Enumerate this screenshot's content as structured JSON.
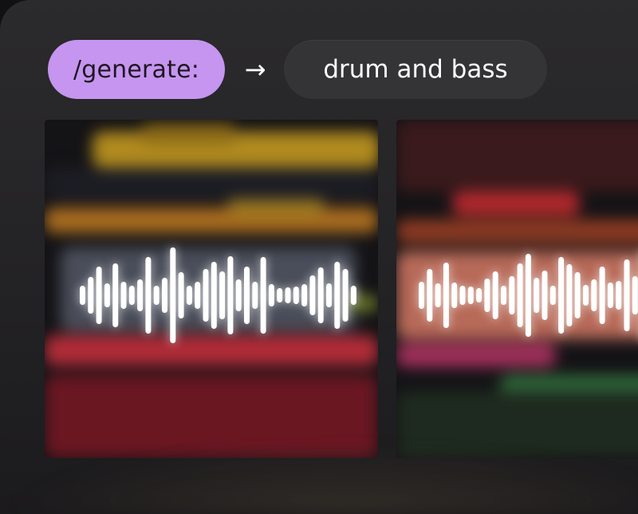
{
  "command": {
    "label": "/generate:"
  },
  "arrow": {
    "glyph": "→"
  },
  "prompt": {
    "label": "drum and bass"
  },
  "colors": {
    "command_pill": "#c595ef",
    "prompt_pill": "#343336",
    "background": "#232224"
  },
  "icons": [
    "arrow-right-icon",
    "audio-waveform-icon"
  ]
}
